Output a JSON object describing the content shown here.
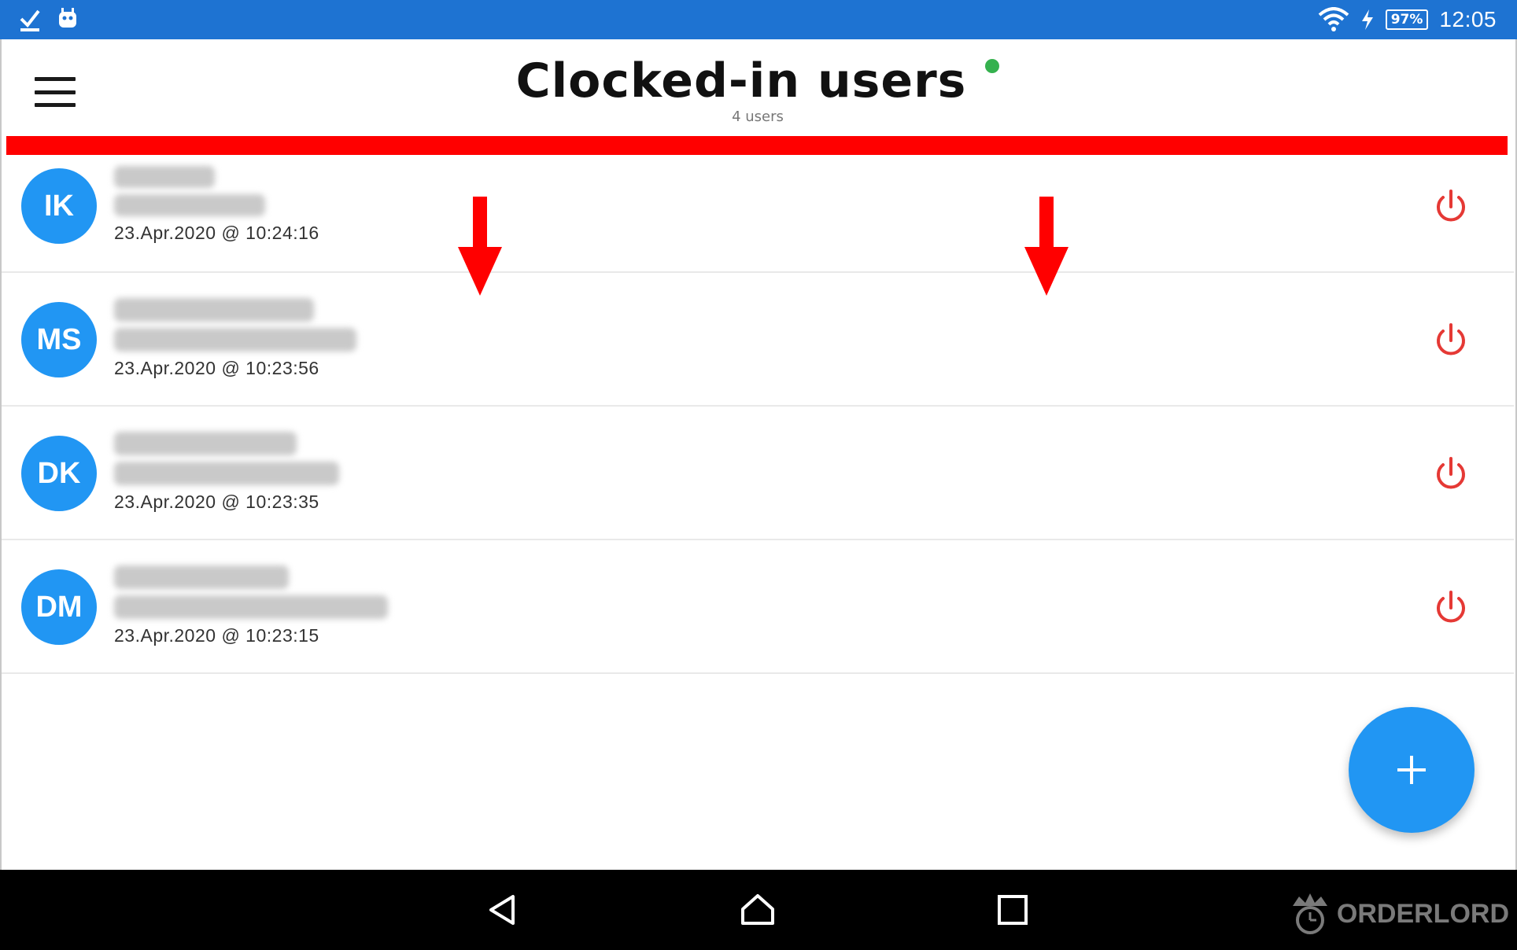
{
  "status_bar": {
    "battery": "97%",
    "time": "12:05",
    "icons": [
      "checkmark-icon",
      "robot-icon",
      "wifi-icon",
      "charging-bolt-icon",
      "battery-icon"
    ]
  },
  "header": {
    "title": "Clocked-in users",
    "subtitle": "4 users",
    "online_indicator_color": "#35b14e"
  },
  "users": [
    {
      "initials": "IK",
      "time": "23.Apr.2020 @ 10:24:16"
    },
    {
      "initials": "MS",
      "time": "23.Apr.2020 @ 10:23:56"
    },
    {
      "initials": "DK",
      "time": "23.Apr.2020 @ 10:23:35"
    },
    {
      "initials": "DM",
      "time": "23.Apr.2020 @ 10:23:15"
    }
  ],
  "fab": {
    "icon": "plus-icon"
  },
  "nav_bar": {
    "buttons": [
      "back-icon",
      "home-icon",
      "recents-icon"
    ]
  },
  "brand": "ORDERLORD",
  "colors": {
    "status_bar": "#1e73d2",
    "avatar": "#2196f3",
    "power": "#e53935",
    "annotation": "#ff0000"
  }
}
